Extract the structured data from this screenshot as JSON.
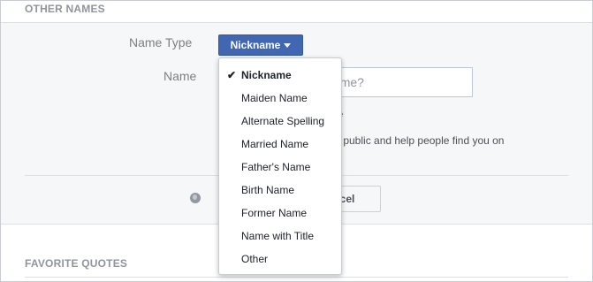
{
  "header": {
    "title": "OTHER NAMES"
  },
  "form": {
    "name_type_label": "Name Type",
    "name_type_selected": "Nickname",
    "name_label": "Name",
    "name_placeholder": "What's your other name?",
    "name_placeholder_visible": "me?",
    "checkbox_label_visible": "le",
    "help_text_visible": "s public and help people find you on",
    "cancel_label_visible": "ancel"
  },
  "dropdown": {
    "items": [
      {
        "label": "Nickname",
        "selected": true
      },
      {
        "label": "Maiden Name",
        "selected": false
      },
      {
        "label": "Alternate Spelling",
        "selected": false
      },
      {
        "label": "Married Name",
        "selected": false
      },
      {
        "label": "Father's Name",
        "selected": false
      },
      {
        "label": "Birth Name",
        "selected": false
      },
      {
        "label": "Former Name",
        "selected": false
      },
      {
        "label": "Name with Title",
        "selected": false
      },
      {
        "label": "Other",
        "selected": false
      }
    ]
  },
  "quotes": {
    "title": "FAVORITE QUOTES"
  },
  "colors": {
    "accent": "#4267b2",
    "label": "#7f7f7f",
    "section_title": "#90949c"
  },
  "icons": {
    "check": "checkmark-icon",
    "caret": "chevron-down-icon",
    "globe": "globe-icon"
  }
}
